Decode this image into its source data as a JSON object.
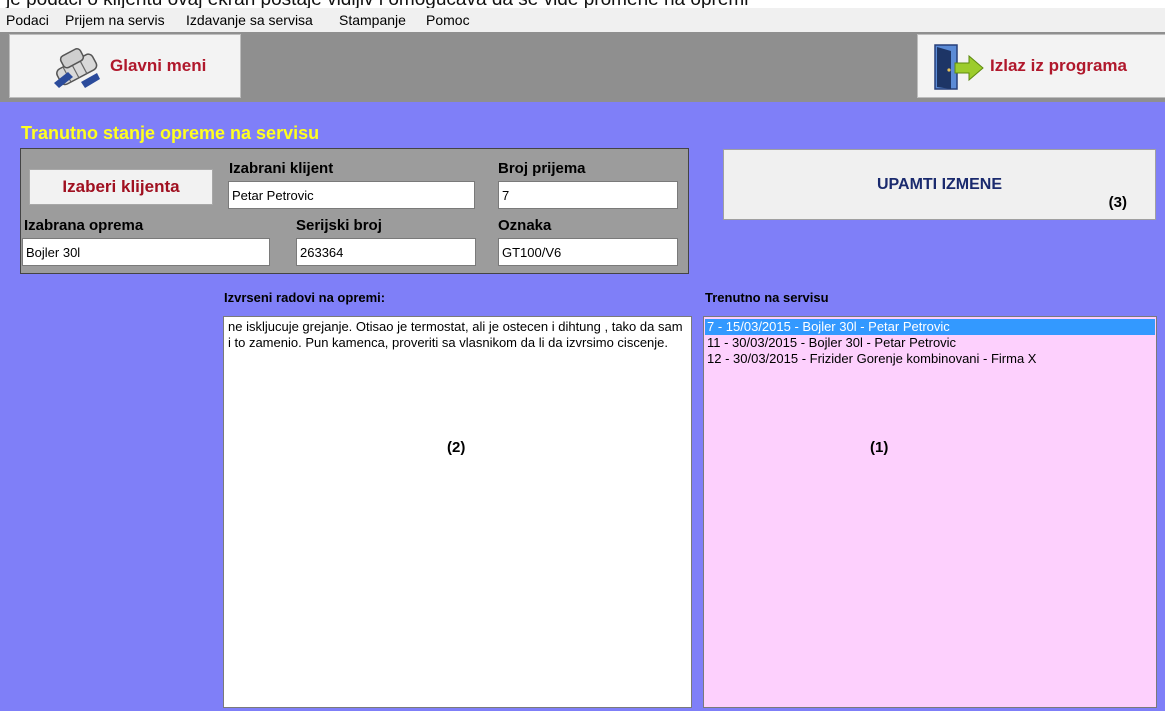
{
  "top_cutoff_text": "je podaci o klijentu ovaj ekran postaje vidljiv i omogucava da se vide promene na opremi",
  "menu": [
    "Podaci",
    "Prijem na servis",
    "Izdavanje sa servisa",
    "Stampanje",
    "Pomoc"
  ],
  "toolbar": {
    "main_menu_label": "Glavni meni",
    "main_menu_icon": "hands-icon",
    "exit_label": "Izlaz iz programa",
    "exit_icon": "exit-door-icon"
  },
  "panel_title": "Tranutno stanje opreme na servisu",
  "form": {
    "pick_client_button": "Izaberi klijenta",
    "client_label": "Izabrani klijent",
    "client_value": "Petar Petrovic",
    "intake_label": "Broj prijema",
    "intake_value": "7",
    "equipment_label": "Izabrana oprema",
    "equipment_value": "Bojler 30l",
    "serial_label": "Serijski broj",
    "serial_value": "263364",
    "tag_label": "Oznaka",
    "tag_value": "GT100/V6"
  },
  "save_button": {
    "label": "UPAMTI IZMENE",
    "marker": "(3)"
  },
  "works": {
    "label": "Izvrseni radovi na opremi:",
    "text": "ne iskljucuje grejanje. Otisao je termostat, ali je ostecen i dihtung , tako da sam i to zamenio. Pun kamenca, proveriti sa vlasnikom da li da izvrsimo ciscenje.",
    "marker": "(2)"
  },
  "in_service": {
    "label": "Trenutno na servisu",
    "items": [
      "7 - 15/03/2015 - Bojler 30l - Petar Petrovic",
      "11 - 30/03/2015 - Bojler 30l - Petar Petrovic",
      "12 - 30/03/2015 - Frizider Gorenje kombinovani - Firma X"
    ],
    "selected_index": 0,
    "marker": "(1)"
  },
  "colors": {
    "background": "#7f7ff8",
    "list_background": "#fdd0fd",
    "title": "#ffff20",
    "selection": "#3399ff",
    "button_text": "#a01020"
  }
}
